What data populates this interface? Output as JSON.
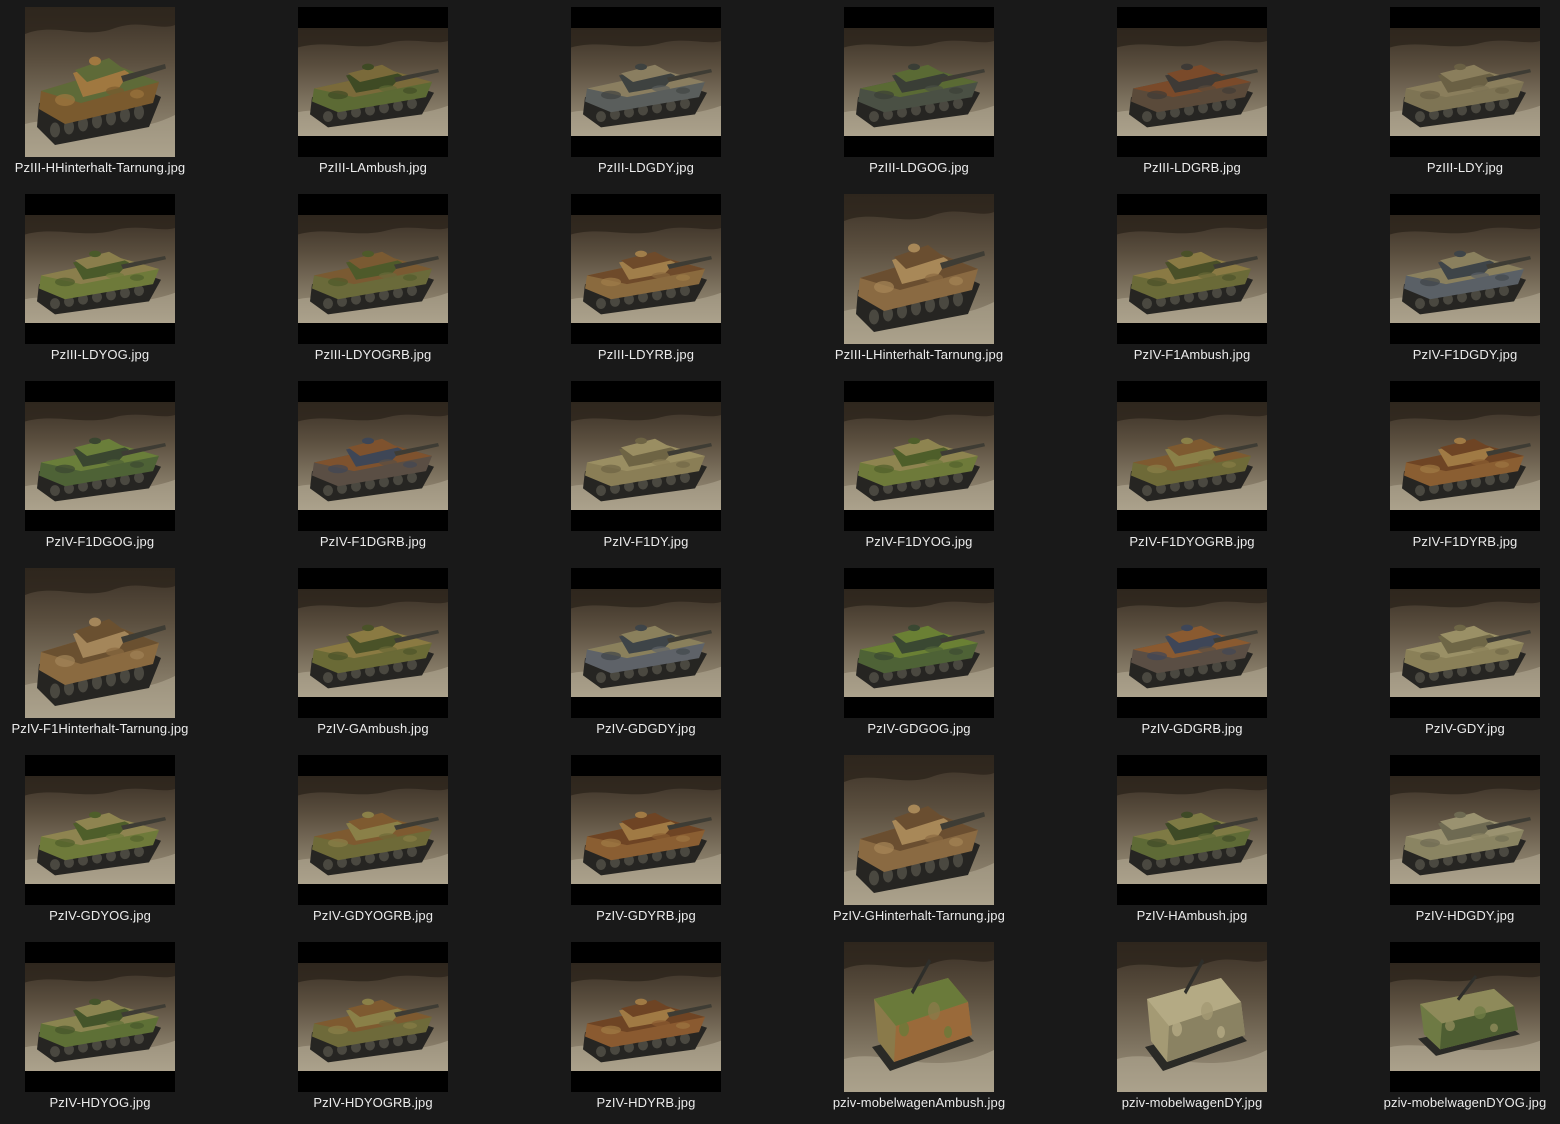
{
  "window": {
    "background": "#191919",
    "view": "large-icons"
  },
  "files": [
    {
      "name": "PzIII-HHinterhalt-Tarnung.jpg",
      "fit": "full",
      "vehicle": "tank",
      "camo": [
        "#7a5a2e",
        "#5e6a38",
        "#a07840"
      ]
    },
    {
      "name": "PzIII-LAmbush.jpg",
      "fit": "wide",
      "vehicle": "tank",
      "camo": [
        "#5c6a34",
        "#7a6a3a",
        "#3e4a24"
      ]
    },
    {
      "name": "PzIII-LDGDY.jpg",
      "fit": "wide",
      "vehicle": "tank",
      "camo": [
        "#5a5e5c",
        "#8a7e60",
        "#3e4240"
      ]
    },
    {
      "name": "PzIII-LDGOG.jpg",
      "fit": "wide",
      "vehicle": "tank",
      "camo": [
        "#4a5044",
        "#5a6a34",
        "#3a3e36"
      ]
    },
    {
      "name": "PzIII-LDGRB.jpg",
      "fit": "wide",
      "vehicle": "tank",
      "camo": [
        "#5a4a3a",
        "#7a4a2a",
        "#3e3a36"
      ]
    },
    {
      "name": "PzIII-LDY.jpg",
      "fit": "wide",
      "vehicle": "tank",
      "camo": [
        "#7e7454",
        "#8a7e5c",
        "#6a6044"
      ]
    },
    {
      "name": "PzIII-LDYOG.jpg",
      "fit": "wide",
      "vehicle": "tank",
      "camo": [
        "#6e7a3a",
        "#8a7e4c",
        "#4a5a2a"
      ]
    },
    {
      "name": "PzIII-LDYOGRB.jpg",
      "fit": "wide",
      "vehicle": "tank",
      "camo": [
        "#6a6a3a",
        "#7a5a32",
        "#4e5a2a"
      ]
    },
    {
      "name": "PzIII-LDYRB.jpg",
      "fit": "wide",
      "vehicle": "tank",
      "camo": [
        "#8a6a3e",
        "#6e4a2a",
        "#a07e4a"
      ]
    },
    {
      "name": "PzIII-LHinterhalt-Tarnung.jpg",
      "fit": "full",
      "vehicle": "tank",
      "camo": [
        "#8a6a42",
        "#6a4e30",
        "#a88858"
      ]
    },
    {
      "name": "PzIV-F1Ambush.jpg",
      "fit": "wide",
      "vehicle": "tank",
      "camo": [
        "#6a6a38",
        "#8a7a44",
        "#4a5028"
      ]
    },
    {
      "name": "PzIV-F1DGDY.jpg",
      "fit": "wide",
      "vehicle": "tank",
      "camo": [
        "#5a6066",
        "#8a805e",
        "#3e4448"
      ]
    },
    {
      "name": "PzIV-F1DGOG.jpg",
      "fit": "wide",
      "vehicle": "tank",
      "camo": [
        "#4e6236",
        "#6a7e3a",
        "#3a4630"
      ]
    },
    {
      "name": "PzIV-F1DGRB.jpg",
      "fit": "wide",
      "vehicle": "tank",
      "camo": [
        "#5a4e44",
        "#7e522e",
        "#3e4656"
      ]
    },
    {
      "name": "PzIV-F1DY.jpg",
      "fit": "wide",
      "vehicle": "tank",
      "camo": [
        "#8a7e56",
        "#9a8e62",
        "#6e6444"
      ]
    },
    {
      "name": "PzIV-F1DYOG.jpg",
      "fit": "wide",
      "vehicle": "tank",
      "camo": [
        "#6e7a3a",
        "#8e8450",
        "#4e5e2a"
      ]
    },
    {
      "name": "PzIV-F1DYOGRB.jpg",
      "fit": "wide",
      "vehicle": "tank",
      "camo": [
        "#6e6a38",
        "#7e5a30",
        "#8a8048"
      ]
    },
    {
      "name": "PzIV-F1DYRB.jpg",
      "fit": "wide",
      "vehicle": "tank",
      "camo": [
        "#8a5e32",
        "#6e4424",
        "#a07a44"
      ]
    },
    {
      "name": "PzIV-F1Hinterhalt-Tarnung.jpg",
      "fit": "full",
      "vehicle": "tank",
      "camo": [
        "#8a6a40",
        "#6a5030",
        "#a4865a"
      ]
    },
    {
      "name": "PzIV-GAmbush.jpg",
      "fit": "wide",
      "vehicle": "tank",
      "camo": [
        "#6a6a36",
        "#8a7a42",
        "#4a5228"
      ]
    },
    {
      "name": "PzIV-GDGDY.jpg",
      "fit": "wide",
      "vehicle": "tank",
      "camo": [
        "#5e6268",
        "#8a805c",
        "#3e4448"
      ]
    },
    {
      "name": "PzIV-GDGOG.jpg",
      "fit": "wide",
      "vehicle": "tank",
      "camo": [
        "#4e6236",
        "#6a8034",
        "#3a4832"
      ]
    },
    {
      "name": "PzIV-GDGRB.jpg",
      "fit": "wide",
      "vehicle": "tank",
      "camo": [
        "#5a4e44",
        "#8a5a30",
        "#3e4658"
      ]
    },
    {
      "name": "PzIV-GDY.jpg",
      "fit": "wide",
      "vehicle": "tank",
      "camo": [
        "#8a8058",
        "#9a9066",
        "#6e6646"
      ]
    },
    {
      "name": "PzIV-GDYOG.jpg",
      "fit": "wide",
      "vehicle": "tank",
      "camo": [
        "#6e7a3a",
        "#8e8450",
        "#4e5e2a"
      ]
    },
    {
      "name": "PzIV-GDYOGRB.jpg",
      "fit": "wide",
      "vehicle": "tank",
      "camo": [
        "#6e6a38",
        "#7e5a30",
        "#8a8048"
      ]
    },
    {
      "name": "PzIV-GDYRB.jpg",
      "fit": "wide",
      "vehicle": "tank",
      "camo": [
        "#8a5e32",
        "#6e4424",
        "#a07a44"
      ]
    },
    {
      "name": "PzIV-GHinterhalt-Tarnung.jpg",
      "fit": "full",
      "vehicle": "tank",
      "camo": [
        "#8a6a42",
        "#6a4e30",
        "#a88858"
      ]
    },
    {
      "name": "PzIV-HAmbush.jpg",
      "fit": "wide",
      "vehicle": "tank",
      "camo": [
        "#5e6a36",
        "#7e7a44",
        "#3e4a26"
      ]
    },
    {
      "name": "PzIV-HDGDY.jpg",
      "fit": "wide",
      "vehicle": "tank",
      "camo": [
        "#8a8462",
        "#9a9270",
        "#6e6a52"
      ]
    },
    {
      "name": "PzIV-HDYOG.jpg",
      "fit": "wide",
      "vehicle": "tank",
      "camo": [
        "#5e7036",
        "#8a8450",
        "#44542a"
      ]
    },
    {
      "name": "PzIV-HDYOGRB.jpg",
      "fit": "wide",
      "vehicle": "tank",
      "camo": [
        "#6e6a3a",
        "#7e5a30",
        "#8a8048"
      ]
    },
    {
      "name": "PzIV-HDYRB.jpg",
      "fit": "wide",
      "vehicle": "tank",
      "camo": [
        "#8a5a30",
        "#6e4424",
        "#a07a44"
      ]
    },
    {
      "name": "pziv-mobelwagenAmbush.jpg",
      "fit": "full",
      "vehicle": "flak",
      "camo": [
        "#8a7a4a",
        "#6a7a3a",
        "#9a6a3a"
      ]
    },
    {
      "name": "pziv-mobelwagenDY.jpg",
      "fit": "full",
      "vehicle": "flak",
      "camo": [
        "#a49a74",
        "#b4aa84",
        "#8a8262"
      ]
    },
    {
      "name": "pziv-mobelwagenDYOG.jpg",
      "fit": "wide",
      "vehicle": "flak",
      "camo": [
        "#6e7a44",
        "#8e8a5a",
        "#4e5e32"
      ]
    }
  ]
}
